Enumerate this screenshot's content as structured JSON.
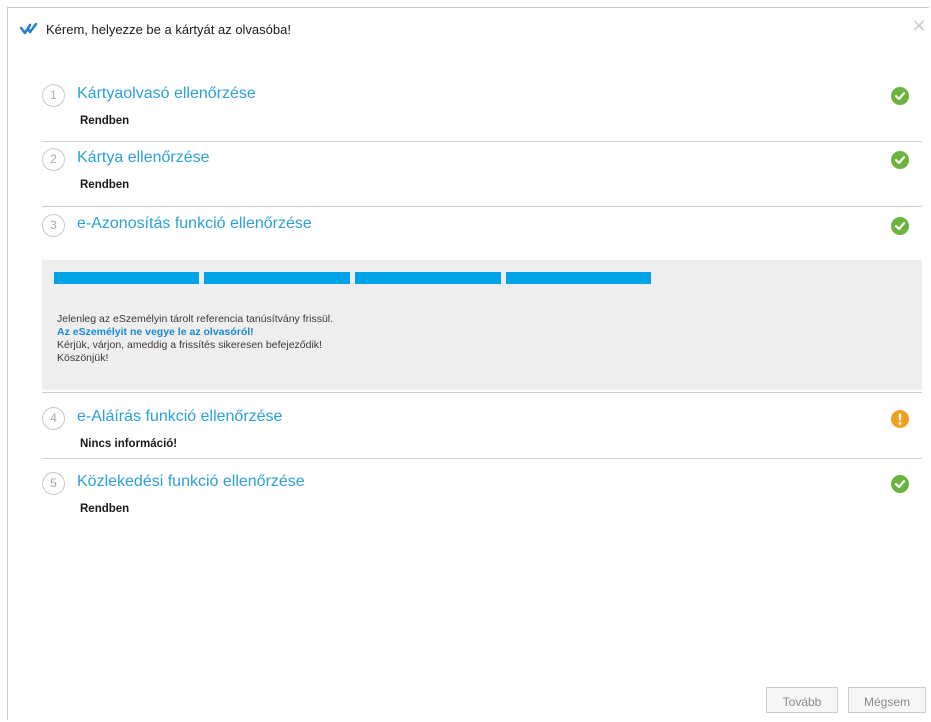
{
  "window": {
    "title": "Kérem, helyezze be a kártyát az olvasóba!",
    "app_icon": "checkmark-logo-icon",
    "close_icon": "close-icon",
    "close_glyph": "✕"
  },
  "colors": {
    "accent": "#2aa0dc",
    "progress": "#00a3e8",
    "ok": "#6cb33f",
    "warning": "#f0a020",
    "warning_text": "#1a8ad4"
  },
  "steps": [
    {
      "num": "1",
      "title": "Kártyaolvasó ellenőrzése",
      "status_text": "Rendben",
      "status_icon": "check-circle-icon"
    },
    {
      "num": "2",
      "title": "Kártya ellenőrzése",
      "status_text": "Rendben",
      "status_icon": "check-circle-icon"
    },
    {
      "num": "3",
      "title": "e-Azonosítás funkció ellenőrzése",
      "status_text": "",
      "status_icon": "check-circle-icon"
    },
    {
      "num": "4",
      "title": "e-Aláírás funkció ellenőrzése",
      "status_text": "Nincs információ!",
      "status_icon": "exclamation-circle-icon"
    },
    {
      "num": "5",
      "title": "Közlekedési funkció ellenőrzése",
      "status_text": "Rendben",
      "status_icon": "check-circle-icon"
    }
  ],
  "update_panel": {
    "progress_segments_filled": 4,
    "line1": "Jelenleg az eSzemélyin tárolt referencia tanúsítvány frissül.",
    "line2": "Az eSzemélyit ne vegye le az olvasóról!",
    "line3": "Kérjük, várjon, ameddig a frissítés sikeresen befejeződik!",
    "line4": "Köszönjük!"
  },
  "buttons": {
    "next": "Tovább",
    "cancel": "Mégsem"
  }
}
